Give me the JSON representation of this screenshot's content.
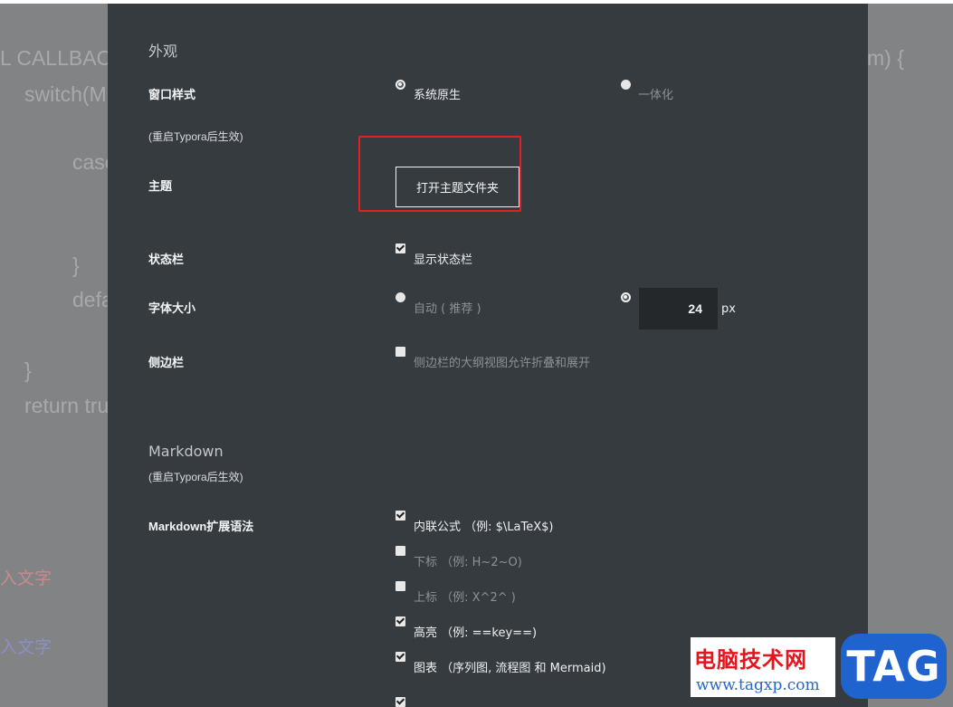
{
  "background": {
    "code_lines": [
      "L CALLBAC",
      "switch(M",
      "case",
      "}",
      "defa",
      "}",
      "return tru",
      "m) {"
    ],
    "faded_lines": [
      "入文字",
      "入文字"
    ]
  },
  "appearance": {
    "section_title": "外观",
    "window_style": {
      "label": "窗口样式",
      "note": "(重启Typora后生效)",
      "options": [
        "系统原生",
        "一体化"
      ],
      "selected": "系统原生"
    },
    "theme": {
      "label": "主题",
      "button_label": "打开主题文件夹"
    },
    "status_bar": {
      "label": "状态栏",
      "option": "显示状态栏",
      "checked": true
    },
    "font_size": {
      "label": "字体大小",
      "auto_option": "自动 ( 推荐 )",
      "value": "24",
      "unit": "px"
    },
    "sidebar": {
      "label": "侧边栏",
      "option": "侧边栏的大纲视图允许折叠和展开",
      "checked": false
    }
  },
  "markdown": {
    "section_title": "Markdown",
    "note": "(重启Typora后生效)",
    "ext_label": "Markdown扩展语法",
    "options": [
      {
        "label": "内联公式 （例: $\\LaTeX$)",
        "checked": true
      },
      {
        "label": "下标 （例: H~2~O)",
        "checked": false
      },
      {
        "label": "上标 （例: X^2^ )",
        "checked": false
      },
      {
        "label": "高亮 （例: ==key==)",
        "checked": true
      },
      {
        "label": "图表 （序列图, 流程图 和 Mermaid)",
        "checked": true
      }
    ]
  },
  "watermark": {
    "title": "电脑技术网",
    "url": "www.tagxp.com",
    "tag": "TAG"
  },
  "colors": {
    "panel_bg": "#363b3f",
    "highlight_red": "#e12222",
    "watermark_blue": "#1f63cf"
  }
}
